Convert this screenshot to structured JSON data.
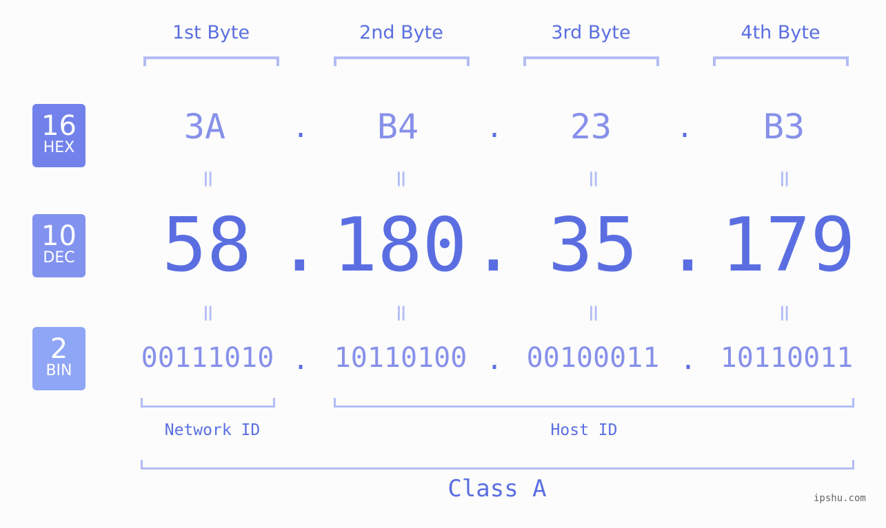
{
  "badges": [
    {
      "num": "16",
      "label": "HEX",
      "color": "#7282ea"
    },
    {
      "num": "10",
      "label": "DEC",
      "color": "#8292ef"
    },
    {
      "num": "2",
      "label": "BIN",
      "color": "#8fa6f6"
    }
  ],
  "byte_headers": [
    "1st Byte",
    "2nd Byte",
    "3rd Byte",
    "4th Byte"
  ],
  "hex": [
    "3A",
    "B4",
    "23",
    "B3"
  ],
  "dec": [
    "58",
    "180",
    "35",
    "179"
  ],
  "bin": [
    "00111010",
    "10110100",
    "00100011",
    "10110011"
  ],
  "separator": ".",
  "equals": "=",
  "network_label": "Network ID",
  "host_label": "Host ID",
  "class_label": "Class A",
  "watermark": "ipshu.com",
  "colors": {
    "accent": "#5b6ee1",
    "light": "#8790ea",
    "bracket": "#b3bcf5"
  }
}
